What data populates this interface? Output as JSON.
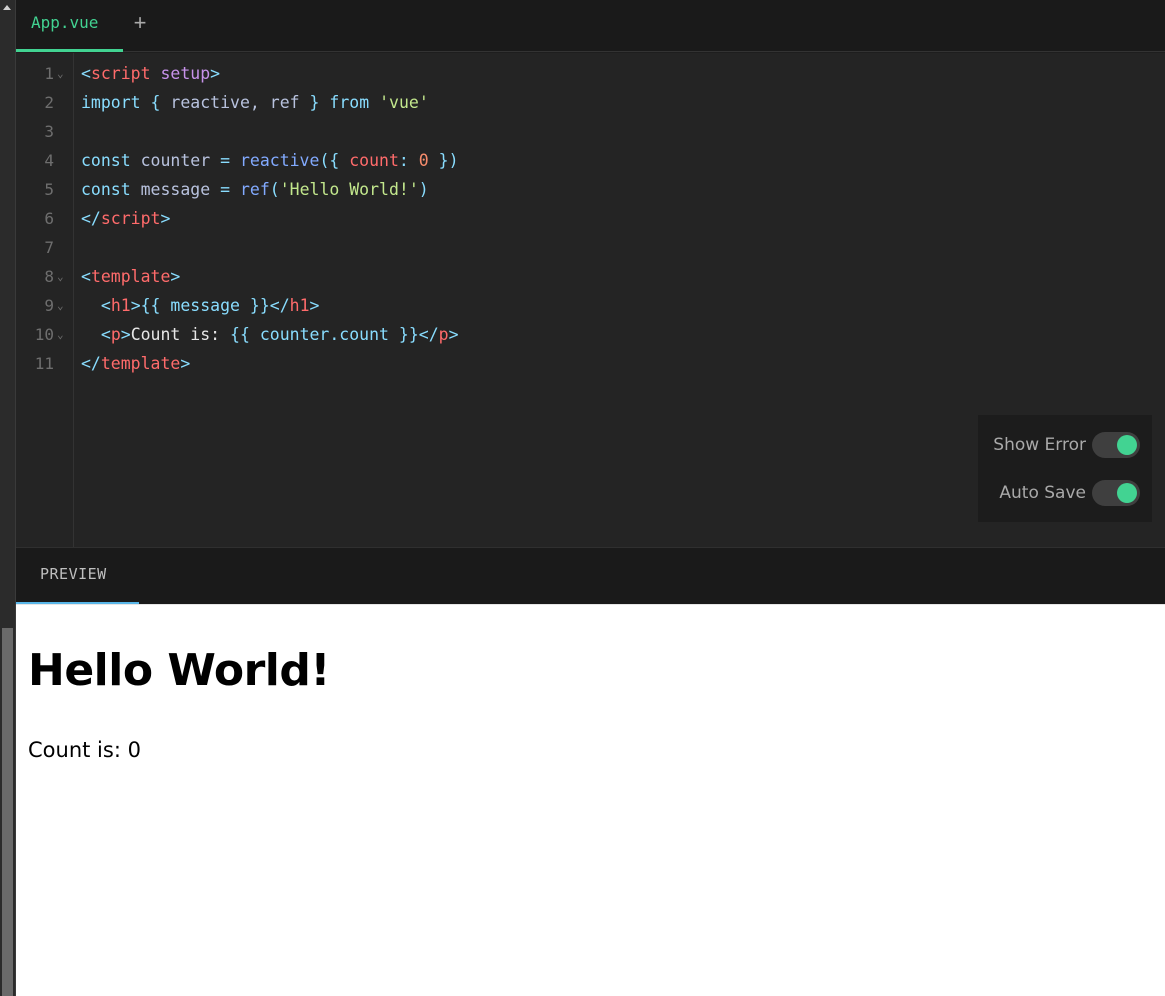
{
  "tabs": {
    "file_tab_label": "App.vue",
    "add_tab_label": "+"
  },
  "editor": {
    "line_numbers": [
      "1",
      "2",
      "3",
      "4",
      "5",
      "6",
      "7",
      "8",
      "9",
      "10",
      "11"
    ],
    "fold_marker": "⌄",
    "lines": {
      "l1": {
        "open": "<",
        "tag": "script",
        "attr": "setup",
        "close": ">"
      },
      "l2": {
        "kw1": "import",
        "brace_open": " { ",
        "id1": "reactive",
        "comma": ", ",
        "id2": "ref",
        "brace_close": " } ",
        "kw2": "from",
        "sp": " ",
        "str": "'vue'"
      },
      "l4": {
        "kw": "const",
        "name": " counter ",
        "eq": "= ",
        "fn": "reactive",
        "paren_open": "({ ",
        "prop": "count",
        "colon": ": ",
        "num": "0",
        "paren_close": " })"
      },
      "l5": {
        "kw": "const",
        "name": " message ",
        "eq": "= ",
        "fn": "ref",
        "paren_open": "(",
        "str": "'Hello World!'",
        "paren_close": ")"
      },
      "l6": {
        "open": "</",
        "tag": "script",
        "close": ">"
      },
      "l8": {
        "open": "<",
        "tag": "template",
        "close": ">"
      },
      "l9": {
        "indent": "  ",
        "open": "<",
        "tag": "h1",
        "close": ">",
        "mustache": "{{ message }}",
        "open2": "</",
        "tag2": "h1",
        "close2": ">"
      },
      "l10": {
        "indent": "  ",
        "open": "<",
        "tag": "p",
        "close": ">",
        "text": "Count is: ",
        "mustache": "{{ counter.count }}",
        "open2": "</",
        "tag2": "p",
        "close2": ">"
      },
      "l11": {
        "open": "</",
        "tag": "template",
        "close": ">"
      }
    }
  },
  "toggles": {
    "show_error": {
      "label": "Show Error",
      "on": true
    },
    "auto_save": {
      "label": "Auto Save",
      "on": true
    }
  },
  "preview": {
    "tab_label": "PREVIEW",
    "heading": "Hello World!",
    "paragraph": "Count is: 0"
  },
  "colors": {
    "accent_green": "#42d392",
    "accent_blue": "#59b6e8",
    "editor_bg": "#242424"
  }
}
